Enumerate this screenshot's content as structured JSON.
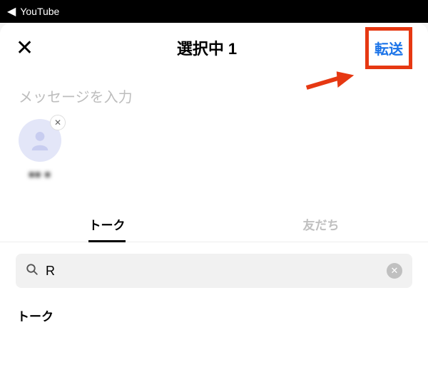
{
  "status_bar": {
    "back_label": "YouTube"
  },
  "header": {
    "title": "選択中 1",
    "forward_label": "転送"
  },
  "message": {
    "placeholder": "メッセージを入力"
  },
  "selected": {
    "items": [
      {
        "name": "■■ ■"
      }
    ]
  },
  "tabs": {
    "talk": "トーク",
    "friends": "友だち"
  },
  "search": {
    "value": "R"
  },
  "section": {
    "talk_label": "トーク"
  }
}
